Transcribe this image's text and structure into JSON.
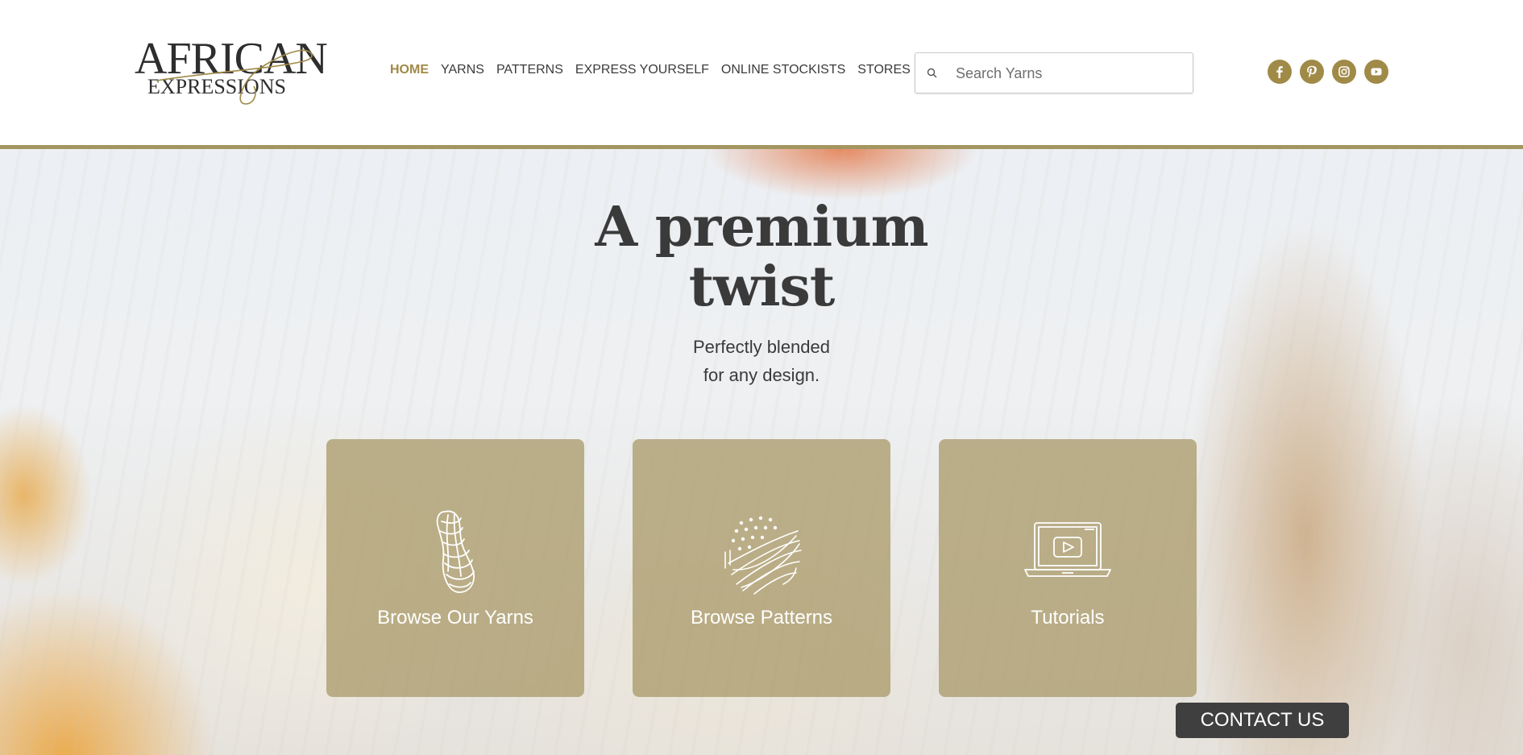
{
  "brand": {
    "logo_line1": "AFRICAN",
    "logo_line2": "EXPRESSIONS",
    "gold": "#a08a47",
    "rule_color": "#a39660"
  },
  "nav": {
    "items": [
      {
        "label": "HOME",
        "active": true
      },
      {
        "label": "YARNS",
        "active": false
      },
      {
        "label": "PATTERNS",
        "active": false
      },
      {
        "label": "EXPRESS YOURSELF",
        "active": false
      },
      {
        "label": "ONLINE STOCKISTS",
        "active": false
      },
      {
        "label": "STORES",
        "active": false
      }
    ]
  },
  "search": {
    "placeholder": "Search Yarns",
    "value": "",
    "icon": "search-icon"
  },
  "social": [
    {
      "name": "facebook",
      "icon": "facebook-icon"
    },
    {
      "name": "pinterest",
      "icon": "pinterest-icon"
    },
    {
      "name": "instagram",
      "icon": "instagram-icon"
    },
    {
      "name": "youtube",
      "icon": "youtube-icon"
    }
  ],
  "hero": {
    "title_line1": "A premium",
    "title_line2": "twist",
    "subtitle_line1": "Perfectly blended",
    "subtitle_line2": "for any design."
  },
  "cards": [
    {
      "label": "Browse Our Yarns",
      "icon": "yarn-skein-icon"
    },
    {
      "label": "Browse Patterns",
      "icon": "pattern-swatch-icon"
    },
    {
      "label": "Tutorials",
      "icon": "laptop-video-icon"
    }
  ],
  "contact": {
    "label": "CONTACT US"
  }
}
